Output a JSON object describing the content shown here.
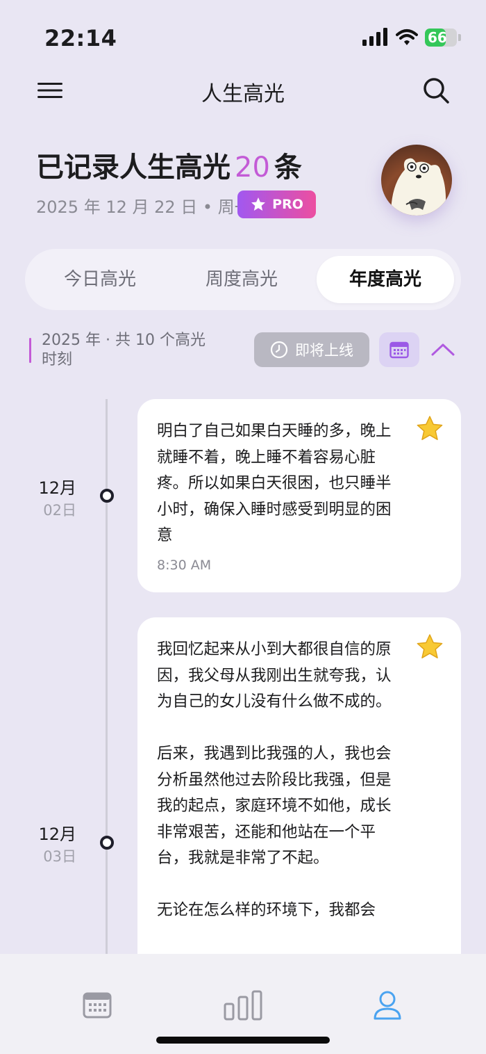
{
  "status_bar": {
    "time": "22:14",
    "battery": "66",
    "battery_level": 0.66
  },
  "nav": {
    "title": "人生高光"
  },
  "header": {
    "headline_prefix": "已记录人生高光",
    "count": "20",
    "headline_suffix": "条",
    "date": "2025 年 12 月 22 日 • 周一",
    "pro_label": "PRO"
  },
  "tabs": [
    {
      "label": "今日高光",
      "active": false
    },
    {
      "label": "周度高光",
      "active": false
    },
    {
      "label": "年度高光",
      "active": true
    }
  ],
  "year_summary": {
    "text": "2025 年 · 共 10 个高光时刻",
    "coming_soon_label": "即将上线"
  },
  "entries": [
    {
      "month": "12月",
      "day": "02日",
      "text": "明白了自己如果白天睡的多，晚上就睡不着，晚上睡不着容易心脏疼。所以如果白天很困，也只睡半小时，确保入睡时感受到明显的困意",
      "time": "8:30 AM",
      "icon": "star-icon"
    },
    {
      "month": "12月",
      "day": "03日",
      "text": "我回忆起来从小到大都很自信的原因，我父母从我刚出生就夸我，认为自己的女儿没有什么做不成的。\n\n后来，我遇到比我强的人，我也会分析虽然他过去阶段比我强，但是我的起点，家庭环境不如他，成长非常艰苦，还能和他站在一个平台，我就是非常了不起。\n\n无论在怎么样的环境下，我都会",
      "icon": "star-icon"
    }
  ],
  "tab_bar": {
    "items": [
      "calendar-icon",
      "chart-icon",
      "profile-icon"
    ],
    "active_color": "#4aa3f0",
    "inactive_color": "#9a9aa3"
  },
  "colors": {
    "accent": "#c35bd6",
    "background": "#e9e6f3"
  }
}
